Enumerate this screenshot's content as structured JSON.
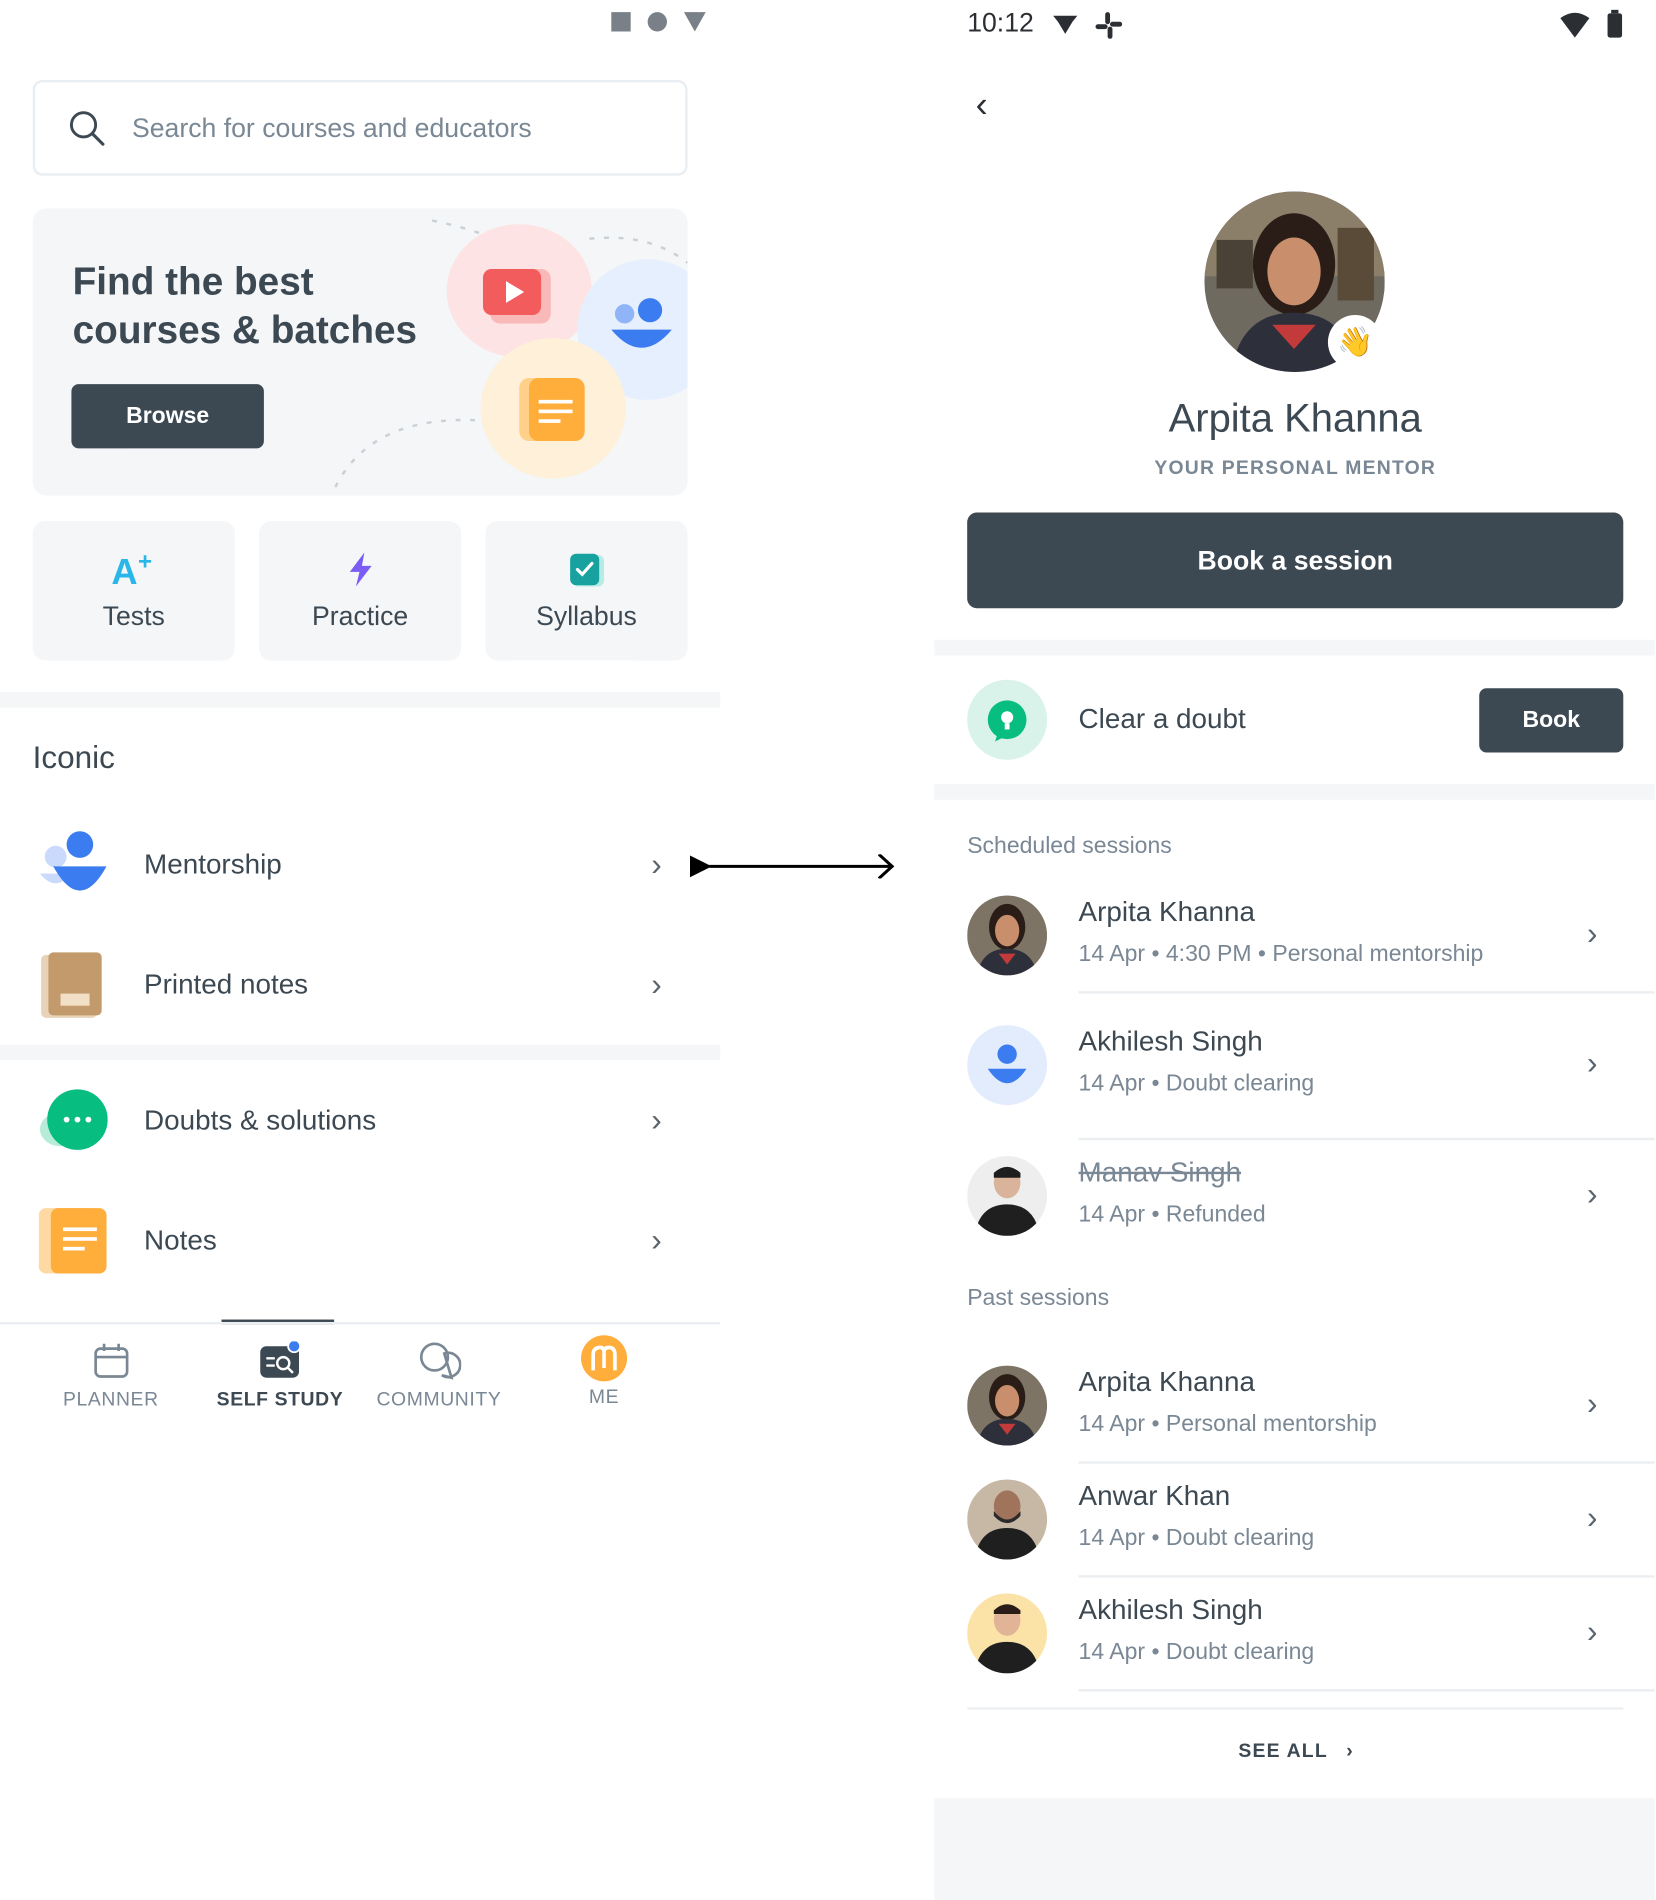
{
  "left_screen": {
    "search": {
      "placeholder": "Search for courses and educators"
    },
    "banner": {
      "title": "Find the best courses & batches",
      "button": "Browse"
    },
    "tiles": [
      {
        "label": "Tests",
        "icon": "a-plus-icon"
      },
      {
        "label": "Practice",
        "icon": "lightning-icon"
      },
      {
        "label": "Syllabus",
        "icon": "checkbox-icon"
      }
    ],
    "section_title": "Iconic",
    "rows": [
      {
        "label": "Mentorship",
        "icon": "mentorship-icon"
      },
      {
        "label": "Printed notes",
        "icon": "book-icon"
      },
      {
        "label": "Doubts & solutions",
        "icon": "chat-bubble-icon"
      },
      {
        "label": "Notes",
        "icon": "notes-icon"
      }
    ],
    "bottom_nav": [
      {
        "label": "PLANNER",
        "icon": "calendar-icon",
        "active": false
      },
      {
        "label": "SELF STUDY",
        "icon": "self-study-icon",
        "active": true
      },
      {
        "label": "COMMUNITY",
        "icon": "community-icon",
        "active": false
      },
      {
        "label": "ME",
        "icon": "profile-logo-icon",
        "active": false
      }
    ]
  },
  "right_screen": {
    "status_time": "10:12",
    "mentor": {
      "name": "Arpita Khanna",
      "subtitle": "YOUR PERSONAL MENTOR",
      "book_label": "Book a session"
    },
    "doubt": {
      "label": "Clear a doubt",
      "button": "Book"
    },
    "scheduled_title": "Scheduled sessions",
    "scheduled": [
      {
        "name": "Arpita Khanna",
        "meta": "14 Apr • 4:30 PM • Personal mentorship",
        "refunded": false
      },
      {
        "name": "Akhilesh Singh",
        "meta": "14 Apr • Doubt clearing",
        "refunded": false
      },
      {
        "name": "Manav Singh",
        "meta": "14 Apr • Refunded",
        "refunded": true
      }
    ],
    "past_title": "Past sessions",
    "past": [
      {
        "name": "Arpita Khanna",
        "meta": "14 Apr • Personal mentorship"
      },
      {
        "name": "Anwar Khan",
        "meta": "14 Apr • Doubt clearing"
      },
      {
        "name": "Akhilesh Singh",
        "meta": "14 Apr • Doubt clearing"
      }
    ],
    "see_all": "SEE ALL"
  },
  "colors": {
    "primary_dark": "#3c4852",
    "muted": "#7a8794",
    "surface": "#f4f6f8",
    "accent_green": "#08bd80",
    "accent_blue": "#3b7cf0",
    "accent_orange": "#ffad3b"
  }
}
